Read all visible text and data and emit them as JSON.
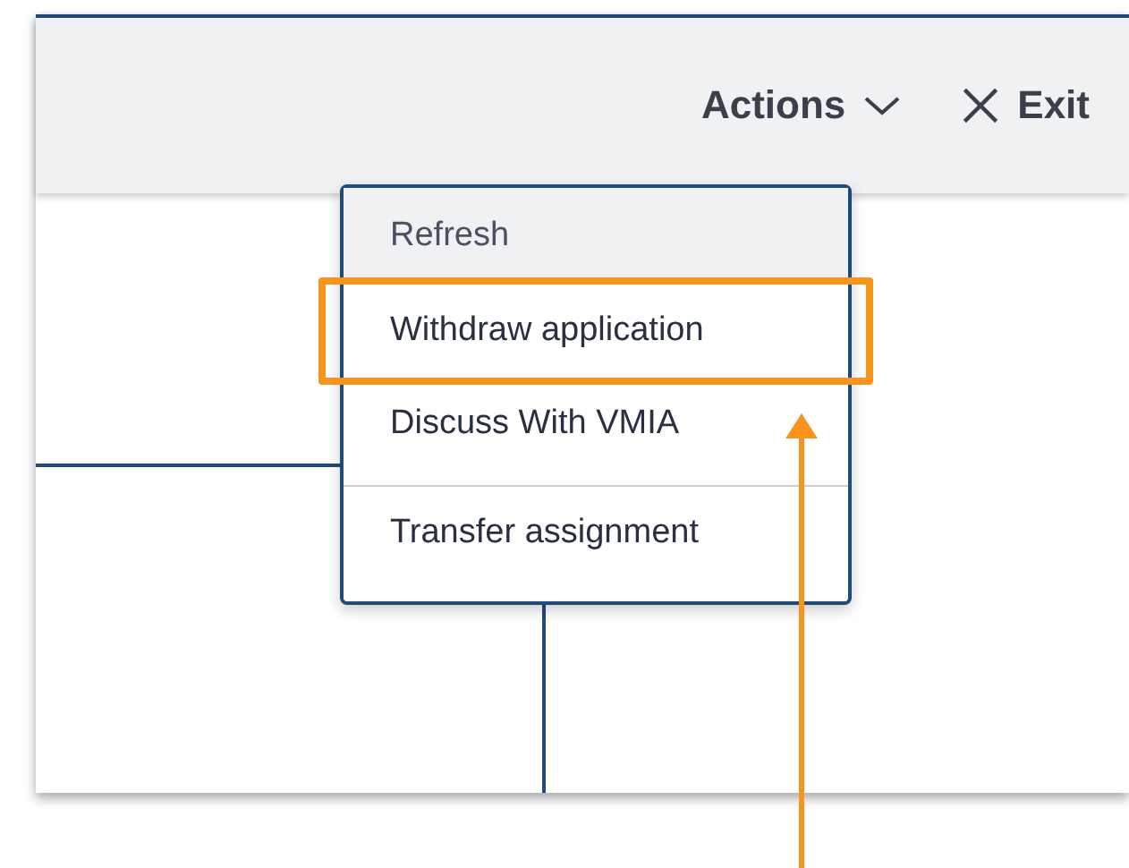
{
  "header": {
    "actions_button": {
      "label": "Actions"
    },
    "exit_button": {
      "label": "Exit"
    }
  },
  "menu": {
    "items": [
      {
        "label": "Refresh",
        "highlighted": true,
        "annotated": false,
        "divider_before": false
      },
      {
        "label": "Withdraw application",
        "highlighted": false,
        "annotated": true,
        "divider_before": false
      },
      {
        "label": "Discuss With VMIA",
        "highlighted": false,
        "annotated": false,
        "divider_before": false
      },
      {
        "label": "Transfer assignment",
        "highlighted": false,
        "annotated": false,
        "divider_before": true
      }
    ]
  }
}
